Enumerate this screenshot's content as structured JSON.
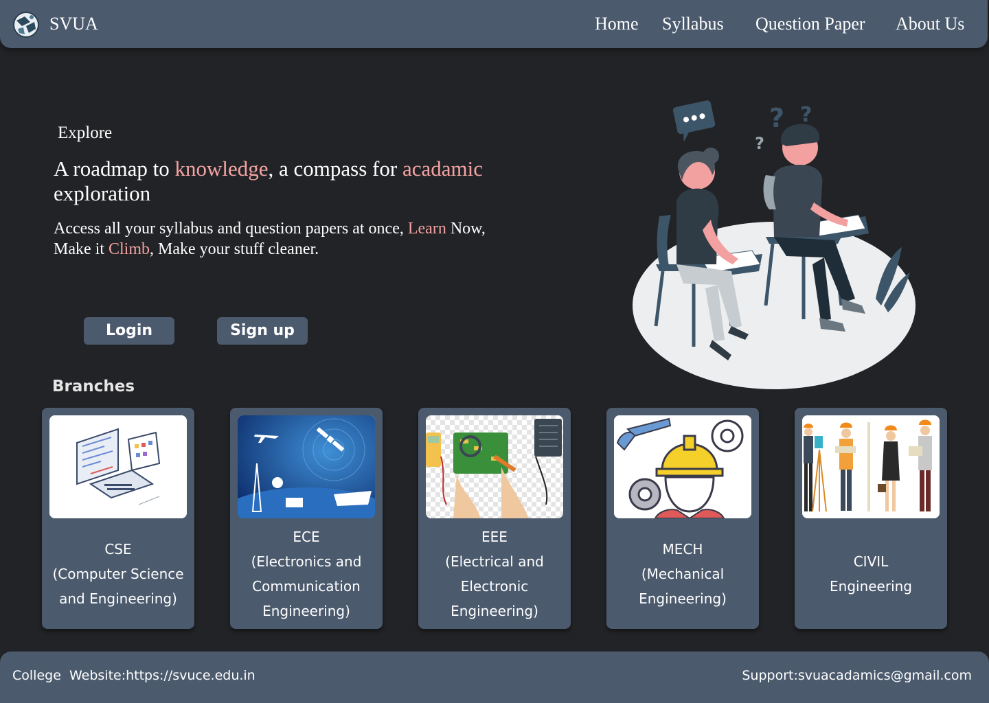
{
  "navbar": {
    "brand": "SVUA",
    "links": [
      "Home",
      "Syllabus",
      "Question Paper",
      "About Us"
    ]
  },
  "hero": {
    "eyebrow": "Explore",
    "headline": {
      "part1": "A roadmap to ",
      "accent1": "knowledge",
      "part2": ", a compass for ",
      "accent2": "acadamic",
      "part3": " exploration"
    },
    "subtext": {
      "part1": "Access all your syllabus and question papers at once, ",
      "accent1": "Learn",
      "part2": " Now, Make it ",
      "accent2": "Climb",
      "part3": ", Make your stuff cleaner."
    },
    "buttons": {
      "login": "Login",
      "signup": "Sign up"
    }
  },
  "branches": {
    "title": "Branches",
    "items": [
      {
        "code": "CSE",
        "lines": [
          "(Computer Science",
          "and Engineering)"
        ],
        "image": "computer-illustration"
      },
      {
        "code": "ECE",
        "lines": [
          "(Electronics and",
          "Communication",
          "Engineering)"
        ],
        "image": "satellite-communication-illustration"
      },
      {
        "code": "EEE",
        "lines": [
          "(Electrical and",
          "Electronic",
          "Engineering)"
        ],
        "image": "circuit-board-illustration"
      },
      {
        "code": "MECH",
        "lines": [
          "(Mechanical",
          "Engineering)"
        ],
        "image": "engineer-gears-illustration"
      },
      {
        "code": "CIVIL",
        "lines": [
          "Engineering"
        ],
        "image": "civil-engineers-illustration"
      }
    ]
  },
  "footer": {
    "left": "College  Website:https://svuce.edu.in",
    "right": "Support:svuacadamics@gmail.com"
  },
  "colors": {
    "background": "#222326",
    "panel": "#4b5a6d",
    "accent": "#f4a3a3"
  }
}
